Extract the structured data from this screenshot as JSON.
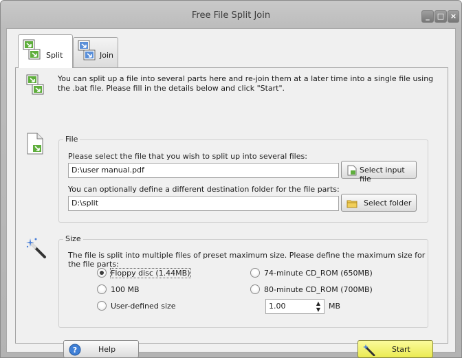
{
  "window": {
    "title": "Free File Split Join",
    "minimize_label": "_",
    "maximize_label": "□",
    "close_label": "×"
  },
  "tabs": [
    {
      "label": "Split",
      "active": true
    },
    {
      "label": "Join",
      "active": false
    }
  ],
  "intro": {
    "text": "You can split up a file into several parts here and re-join them at a later time into a single file using the .bat file. Please fill in the details below and click \"Start\"."
  },
  "file_group": {
    "title": "File",
    "input_label": "Please select the file that you wish to split up into several files:",
    "input_value": "D:\\user manual.pdf",
    "input_button": "Select input file",
    "dest_label": "You can optionally define a different destination folder for the file parts:",
    "dest_value": "D:\\split",
    "dest_button": "Select folder"
  },
  "size_group": {
    "title": "Size",
    "description": "The file is split into multiple files of preset maximum size. Please define the maximum size for the file parts:",
    "options": [
      {
        "label": "Floppy disc (1.44MB)",
        "checked": true
      },
      {
        "label": "100 MB",
        "checked": false
      },
      {
        "label": "User-defined size",
        "checked": false
      },
      {
        "label": "74-minute CD_ROM (650MB)",
        "checked": false
      },
      {
        "label": "80-minute CD_ROM (700MB)",
        "checked": false
      }
    ],
    "custom_value": "1.00",
    "custom_unit": "MB"
  },
  "buttons": {
    "help": "Help",
    "start": "Start"
  },
  "colors": {
    "start_button": "#eaea52",
    "panel_bg": "#f0f0f0"
  }
}
